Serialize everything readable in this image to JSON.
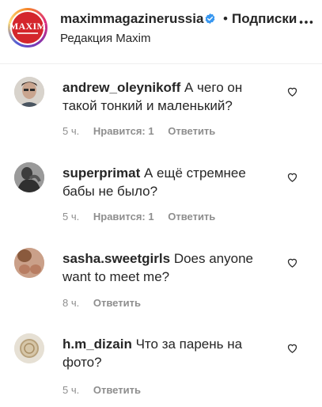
{
  "header": {
    "account_name": "maximmagazinerussia",
    "separator": "•",
    "follow_label": "Подписки",
    "subtitle": "Редакция Maxim",
    "logo_text": "MAXIM",
    "verified_color": "#3897f0",
    "icons": {
      "verified": "verified-badge-icon",
      "more": "more-options-icon"
    }
  },
  "comments": [
    {
      "username": "andrew_oleynikoff",
      "text": "А чего он такой тонкий и маленький?",
      "time": "5 ч.",
      "likes": "Нравится: 1",
      "reply": "Ответить"
    },
    {
      "username": "superprimat",
      "text": "А ещё стремнее бабы не было?",
      "time": "5 ч.",
      "likes": "Нравится: 1",
      "reply": "Ответить"
    },
    {
      "username": "sasha.sweetgirls",
      "text": "Does anyone want to meet me?",
      "time": "8 ч.",
      "reply": "Ответить"
    },
    {
      "username": "h.m_dizain",
      "text": "Что за парень на фото?",
      "time": "5 ч.",
      "reply": "Ответить"
    }
  ]
}
